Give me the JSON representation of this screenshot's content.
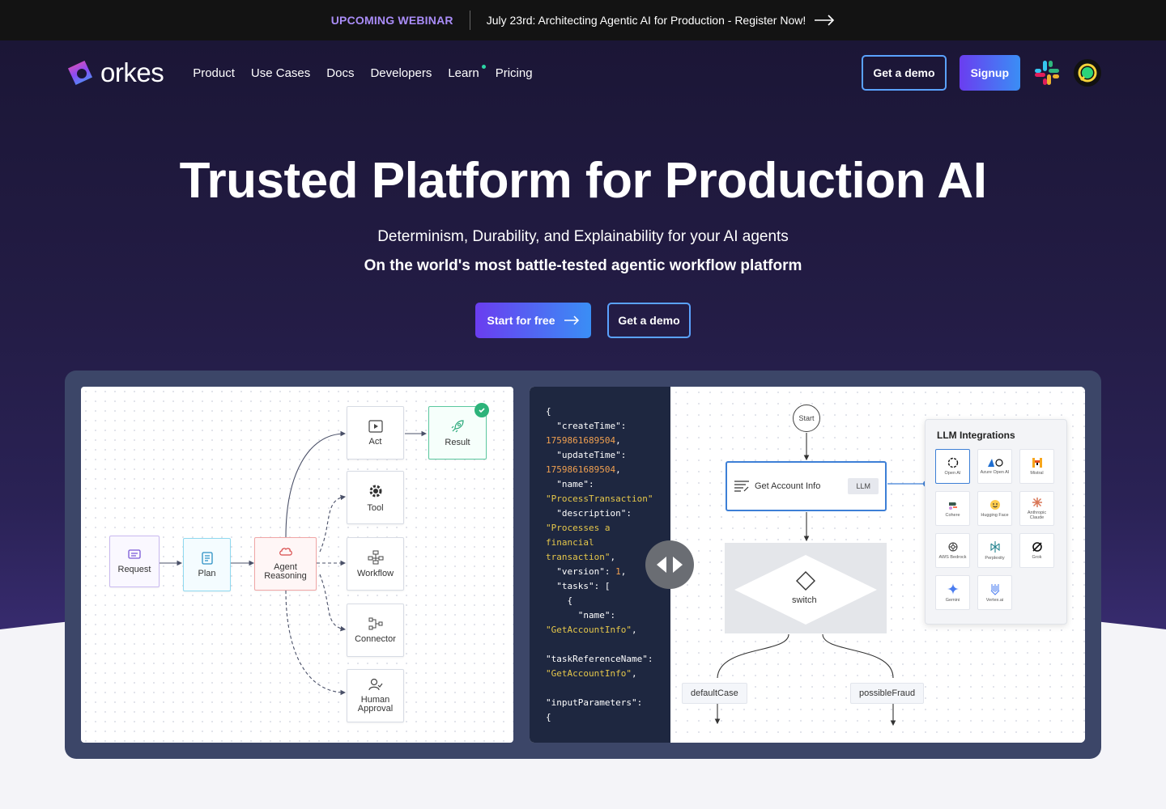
{
  "banner": {
    "tag": "UPCOMING WEBINAR",
    "text": "July 23rd: Architecting Agentic AI for Production - Register Now!"
  },
  "nav": {
    "logo_text": "orkes",
    "links": [
      "Product",
      "Use Cases",
      "Docs",
      "Developers",
      "Learn",
      "Pricing"
    ],
    "demo_label": "Get a demo",
    "signup_label": "Signup"
  },
  "hero": {
    "title": "Trusted Platform for Production AI",
    "subtitle": "Determinism, Durability, and Explainability for your AI agents",
    "tagline": "On the world's most battle-tested agentic workflow platform",
    "start_label": "Start for free",
    "demo_label": "Get a demo"
  },
  "agent_flow": {
    "request": "Request",
    "plan": "Plan",
    "agent_line1": "Agent",
    "agent_line2": "Reasoning",
    "act": "Act",
    "tool": "Tool",
    "workflow": "Workflow",
    "connector": "Connector",
    "human_line1": "Human",
    "human_line2": "Approval",
    "result": "Result"
  },
  "code": {
    "l1": "{",
    "l2": "  \"createTime\":",
    "l3": "1759861689504",
    "l4": "  \"updateTime\":",
    "l5": "1759861689504",
    "l6": "  \"name\":",
    "l7": "\"ProcessTransaction\"",
    "l8": "  \"description\":",
    "l9": "\"Processes a",
    "l10": "financial",
    "l11": "transaction\"",
    "l12": "  \"version\": ",
    "l12n": "1",
    "l13": "  \"tasks\": [",
    "l14": "    {",
    "l15": "      \"name\":",
    "l16": "\"GetAccountInfo\"",
    "l17": "\"taskReferenceName\":",
    "l18": "\"GetAccountInfo\"",
    "l19": "\"inputParameters\":",
    "l20": "{"
  },
  "workflow": {
    "start": "Start",
    "task_name": "Get Account Info",
    "task_tag": "LLM",
    "switch": "switch",
    "case_default": "defaultCase",
    "case_fraud": "possibleFraud"
  },
  "llm": {
    "title": "LLM Integrations",
    "tiles": [
      {
        "name": "Open AI"
      },
      {
        "name": "Azure Open AI"
      },
      {
        "name": "Mistral"
      },
      {
        "name": "Cohere"
      },
      {
        "name": "Hugging Face"
      },
      {
        "name": "Anthropic Claude"
      },
      {
        "name": "AWS Bedrock"
      },
      {
        "name": "Perplexity"
      },
      {
        "name": "Grok"
      },
      {
        "name": "Gemini"
      },
      {
        "name": "Vertex.ai"
      }
    ]
  },
  "colors": {
    "accent_purple": "#6a3df0",
    "accent_blue": "#3a8ef5",
    "banner_tag": "#a98cf7"
  }
}
